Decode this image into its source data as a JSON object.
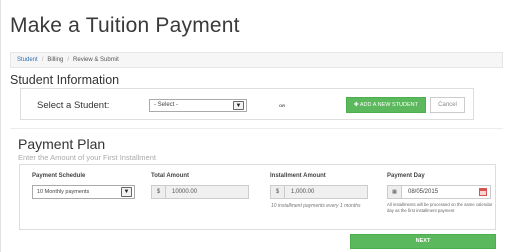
{
  "page": {
    "title": "Make a Tuition Payment"
  },
  "breadcrumb": {
    "items": [
      {
        "label": "Student",
        "active": true
      },
      {
        "label": "Billing",
        "active": false
      },
      {
        "label": "Review & Submit",
        "active": false
      }
    ]
  },
  "student_info": {
    "heading": "Student Information",
    "select_label": "Select a Student:",
    "select_value": "- Select -",
    "or_text": "OR",
    "add_button": "ADD A NEW STUDENT",
    "cancel_button": "Cancel"
  },
  "payment_plan": {
    "heading": "Payment Plan",
    "subtitle": "Enter the Amount of your First Installment",
    "schedule": {
      "label": "Payment Schedule",
      "value": "10 Monthly payments"
    },
    "total": {
      "label": "Total Amount",
      "currency": "$",
      "value": "10000.00"
    },
    "installment": {
      "label": "Installment Amount",
      "currency": "$",
      "value": "1,000.00",
      "note": "10 installment payments every 1 months"
    },
    "payment_day": {
      "label": "Payment Day",
      "value": "08/05/2015",
      "note": "All installments will be processed on the same calendar day as the first installment payment"
    }
  },
  "actions": {
    "next": "NEXT"
  },
  "colors": {
    "accent_green": "#5cb85c",
    "link_blue": "#2f6fb6",
    "calendar_red": "#d9534f"
  }
}
